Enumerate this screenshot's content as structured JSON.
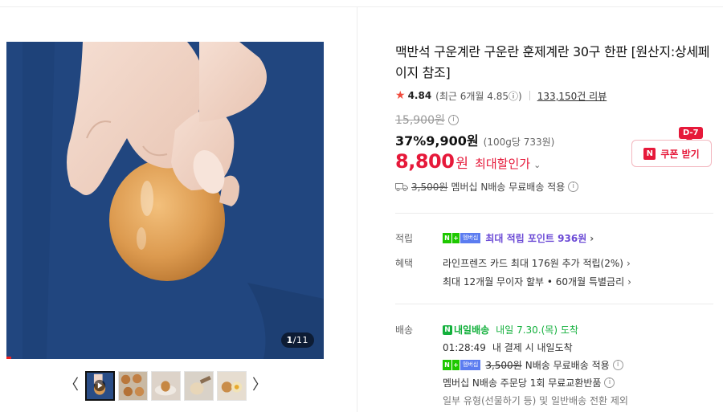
{
  "gallery": {
    "counter_current": "1",
    "counter_total": "/11",
    "prev_arrow": "〈",
    "next_arrow": "〉",
    "thumbnails": [
      {
        "label": "thumb-video-egg-hand"
      },
      {
        "label": "thumb-eggs-tray"
      },
      {
        "label": "thumb-egg-plate"
      },
      {
        "label": "thumb-egg-peeled"
      },
      {
        "label": "thumb-eggs-pair"
      }
    ]
  },
  "product": {
    "title": "맥반석 구운계란 구운란 훈제계란 30구 한판 [원산지:상세페이지 참조]",
    "rating_score": "4.84",
    "rating_recent": "(최근 6개월 4.85ⓘ)",
    "review_count": "133,150건 리뷰",
    "original_price": "15,900원",
    "discount_rate": "37%",
    "sale_price": "9,900원",
    "unit_price": "(100g당 733원)",
    "final_price": "8,800",
    "final_won": "원",
    "max_discount_label": "최대할인가",
    "shipping_old": "3,500원",
    "shipping_text": "멤버십 N배송 무료배송 적용"
  },
  "coupon": {
    "badge": "N",
    "label": "쿠폰 받기",
    "dday": "D-7"
  },
  "points": {
    "label": "적립",
    "membership_badge": "멤버십",
    "text": "최대 적립 포인트 936원"
  },
  "benefits": {
    "label": "혜택",
    "line1": "라인프렌즈 카드 최대 176원 추가 적립(2%)",
    "line2": "최대 12개월 무이자 할부 • 60개월 특별금리"
  },
  "delivery": {
    "label": "배송",
    "badge": "내일배송",
    "arrival": "내일 7.30.(목) 도착",
    "countdown": "01:28:49",
    "countdown_text": "내 결제 시 내일도착",
    "membership_badge": "멤버십",
    "ship_old": "3,500원",
    "ship_text": "N배송 무료배송 적용",
    "exchange_text": "멤버십 N배송 주문당 1회 무료교환반품",
    "note": "일부 유형(선물하기 등) 및 일반배송 전환 제외"
  },
  "colors": {
    "accent_red": "#e6193a",
    "green": "#13b03c",
    "purple": "#6c4bd6",
    "photo_bg": "#21467f"
  }
}
